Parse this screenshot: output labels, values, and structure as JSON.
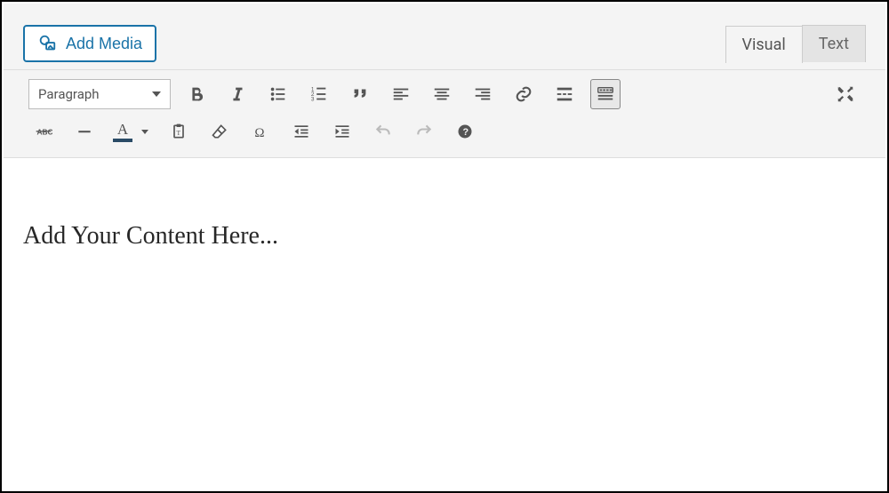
{
  "header": {
    "add_media_label": "Add Media"
  },
  "tabs": {
    "visual": "Visual",
    "text": "Text",
    "active": "visual"
  },
  "toolbar": {
    "format_selected": "Paragraph",
    "row1": {
      "bold": "Bold",
      "italic": "Italic",
      "bulleted_list": "Bulleted list",
      "numbered_list": "Numbered list",
      "blockquote": "Blockquote",
      "align_left": "Align left",
      "align_center": "Align center",
      "align_right": "Align right",
      "link": "Insert/edit link",
      "read_more": "Insert Read More tag",
      "toolbar_toggle": "Toolbar Toggle",
      "fullscreen": "Distraction-free mode"
    },
    "row2": {
      "strikethrough": "Strikethrough",
      "hr": "Horizontal line",
      "text_color": "Text color",
      "paste_text": "Paste as text",
      "clear_formatting": "Clear formatting",
      "special_char": "Special character",
      "outdent": "Decrease indent",
      "indent": "Increase indent",
      "undo": "Undo",
      "redo": "Redo",
      "help": "Keyboard shortcuts"
    }
  },
  "editor": {
    "content": "Add Your Content Here..."
  },
  "colors": {
    "accent": "#1a73a8",
    "text_color_underline": "#2a4b66"
  }
}
